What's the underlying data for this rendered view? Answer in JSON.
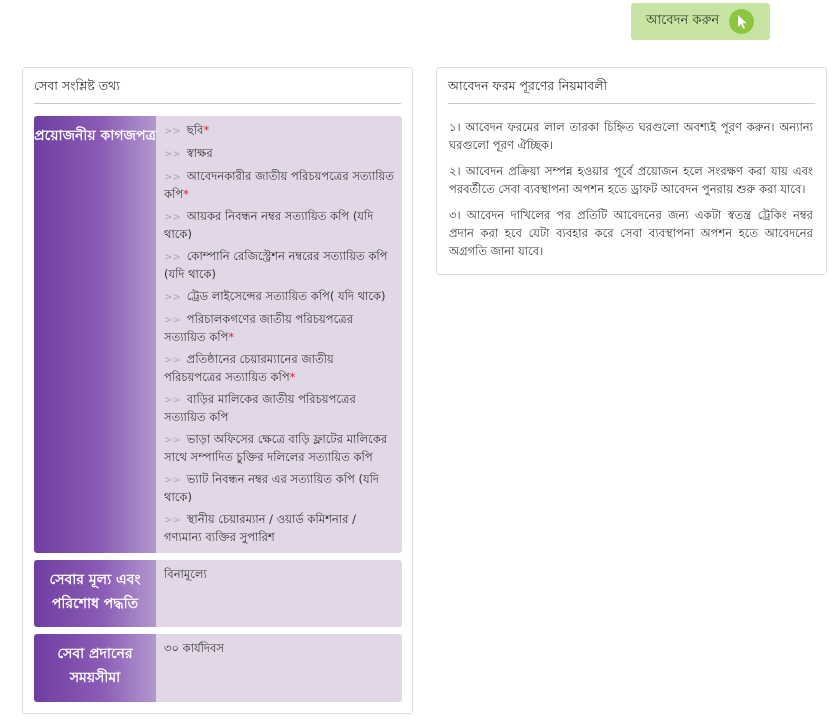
{
  "apply_button": {
    "label": "আবেদন করুন",
    "icon": "pointer-cursor-icon",
    "color": "#c8e4a4",
    "icon_color": "#8cc63f"
  },
  "service_info": {
    "title": "সেবা সংশ্লিষ্ট তথ্য",
    "documents": {
      "label": "প্রয়োজনীয় কাগজপত্র",
      "items": [
        {
          "text": "ছবি",
          "required": "*"
        },
        {
          "text": "স্বাক্ষর",
          "required": ""
        },
        {
          "text": "আবেদনকারীর জাতীয় পরিচয়পত্রের সত্যায়িত কপি",
          "required": "*"
        },
        {
          "text": "আয়কর নিবন্ধন নম্বর সত্যায়িত কপি (যদি থাকে)",
          "required": ""
        },
        {
          "text": "কোম্পানি রেজিস্ট্রেশন নম্বরের সত্যায়িত কপি (যদি থাকে)",
          "required": ""
        },
        {
          "text": "ট্রেড লাইসেন্সের সত্যায়িত কপি( যদি থাকে)",
          "required": ""
        },
        {
          "text": "পরিচালকগণের জাতীয় পরিচয়পত্রের সত্যায়িত কপি",
          "required": "*"
        },
        {
          "text": "প্রতিষ্ঠানের চেয়ারম্যানের জাতীয় পরিচয়পত্রের সত্যায়িত কপি",
          "required": "*"
        },
        {
          "text": "বাড়ির মালিকের জাতীয় পরিচয়পত্রের সত্যায়িত কপি",
          "required": ""
        },
        {
          "text": "ভাড়া অফিসের ক্ষেত্রে বাড়ি ফ্লাটের মালিকের সাথে সম্পাদিত চুক্তির দলিলের সত্যায়িত কপি",
          "required": ""
        },
        {
          "text": "ভ্যাট নিবন্ধন নম্বর এর সত্যায়িত কপি (যদি থাকে)",
          "required": ""
        },
        {
          "text": "স্থানীয় চেয়ারম্যান / ওয়ার্ড কমিশনার / গণ্যমান্য ব্যক্তির সুপারিশ",
          "required": ""
        }
      ]
    },
    "fee": {
      "label": "সেবার মূল্য এবং পরিশোধ পদ্ধতি",
      "value": "বিনামূল্যে"
    },
    "timeframe": {
      "label": "সেবা প্রদানের সময়সীমা",
      "value": "৩০ কার্যদিবস"
    }
  },
  "rules": {
    "title": "আবেদন ফরম পূরণের নিয়মাবলী",
    "items": [
      "১। আবেদন ফরমের লাল তারকা চিহ্নিত ঘরগুলো অবশ্যই পূরণ করুন। অন্যান্য ঘরগুলো পূরণ ঐচ্ছিক।",
      "২। আবেদন প্রক্রিয়া সম্পন্ন হওয়ার পূর্বে প্রয়োজন হলে সংরক্ষণ করা যায় এবং পরবর্তীতে সেবা ব্যবস্থাপনা অপশন হতে ড্রাফট আবেদন পুনরায় শুরু করা যাবে।",
      "৩। আবেদন দাখিলের পর প্রতিটি আবেদনের জন্য একটা স্বতন্ত্র ট্রেকিং নম্বর প্রদান করা হবে যেটা ব্যবহার করে সেবা ব্যবস্থাপনা অপশন হতে আবেদনের অগ্রগতি জানা যাবে।"
    ]
  },
  "colors": {
    "label_gradient_start": "#6f3ea2",
    "label_gradient_end": "#b398cf",
    "row_bg": "#e1d7e7",
    "required": "#d9232e"
  }
}
